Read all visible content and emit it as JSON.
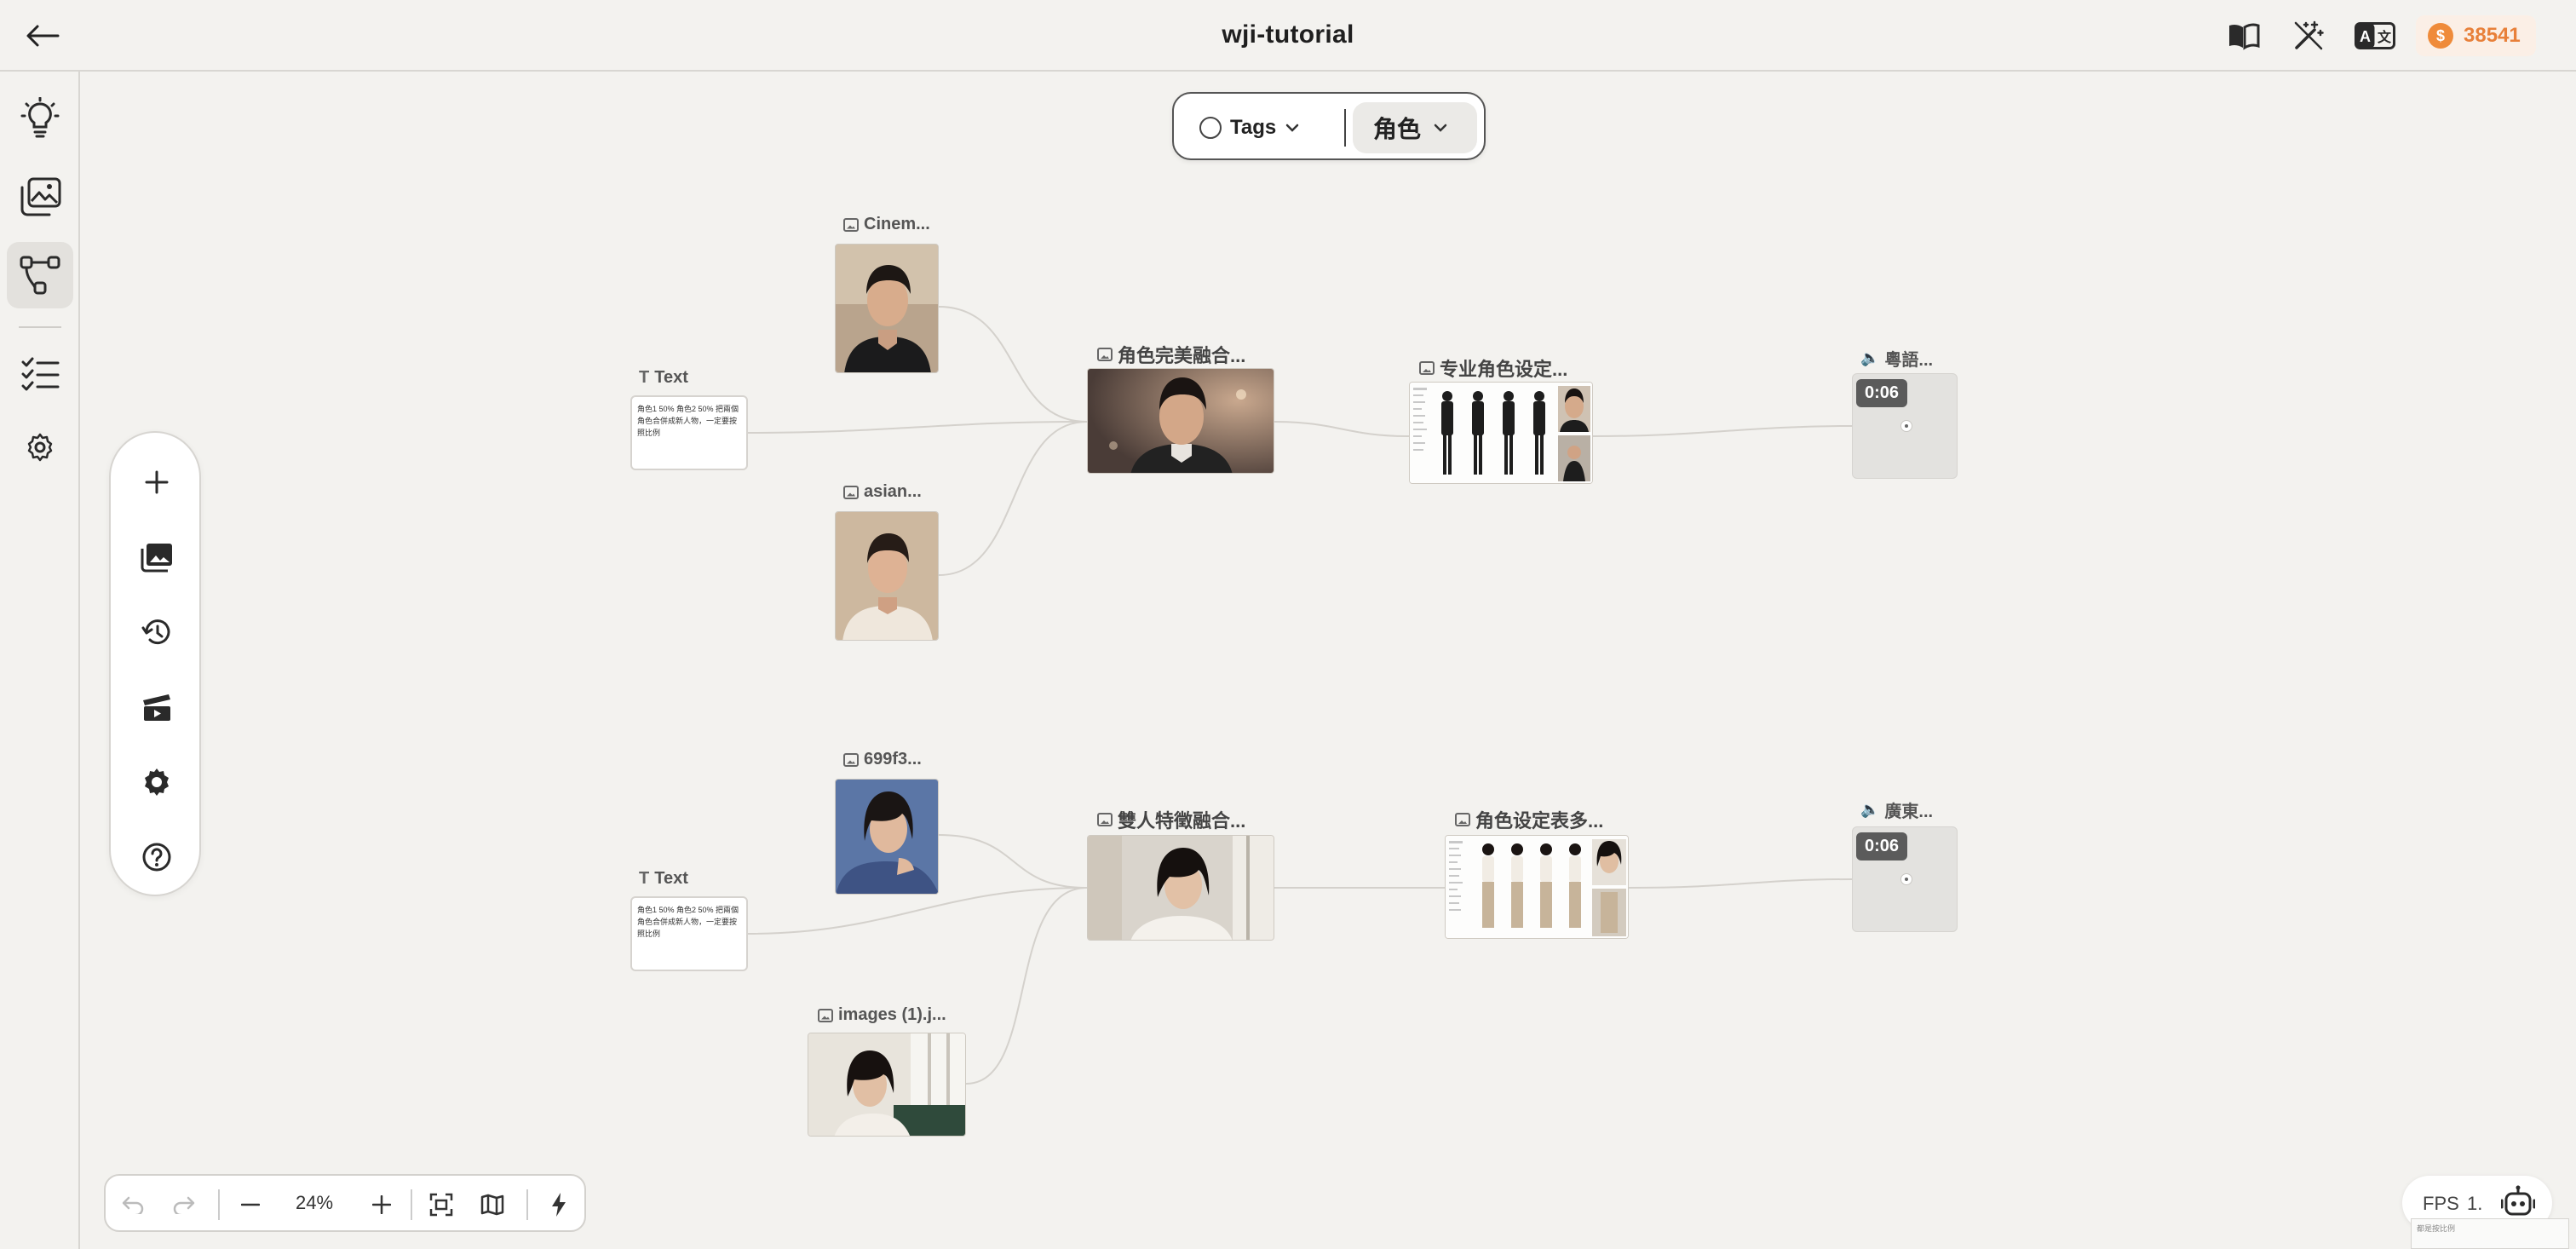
{
  "header": {
    "title": "wji-tutorial",
    "coins": "38541",
    "coin_symbol": "$",
    "icons": [
      "back-arrow-icon",
      "book-icon",
      "magic-wand-icon",
      "translate-icon",
      "coin-icon"
    ]
  },
  "rail": {
    "items": [
      {
        "name": "ideas",
        "icon": "lightbulb-icon"
      },
      {
        "name": "gallery",
        "icon": "images-icon"
      },
      {
        "name": "workflow",
        "icon": "workflow-icon",
        "active": true
      },
      {
        "name": "tasks",
        "icon": "checklist-icon"
      },
      {
        "name": "settings",
        "icon": "gear-icon"
      }
    ]
  },
  "palette": {
    "items": [
      "plus-icon",
      "gallery-icon",
      "history-icon",
      "clapperboard-icon",
      "gear-icon",
      "help-icon"
    ]
  },
  "tag_filter": {
    "tags_label": "Tags",
    "category": "角色"
  },
  "nodes": {
    "group1": {
      "img_a": "Cinem...",
      "img_b": "asian...",
      "text_label": "Text",
      "text_content": "角色1 50% 角色2 50% 把兩個角色合併成新人物，一定要按照比例",
      "merge_label": "角色完美融合...",
      "sheet_label": "专业角色设定...",
      "audio_label": "粵語...",
      "audio_time": "0:06"
    },
    "group2": {
      "img_a": "699f3...",
      "img_b": "images (1).j...",
      "text_label": "Text",
      "text_content": "角色1 50% 角色2 50% 把兩個角色合併成新人物，一定要按照比例",
      "merge_label": "雙人特徵融合...",
      "sheet_label": "角色设定表多...",
      "audio_label": "廣東...",
      "audio_time": "0:06"
    }
  },
  "bottom_bar": {
    "zoom": "24%",
    "icons": [
      "undo-icon",
      "redo-icon",
      "zoom-out-icon",
      "zoom-in-icon",
      "fit-view-icon",
      "map-icon",
      "lightning-icon"
    ]
  },
  "fps": {
    "label": "FPS",
    "value": "1."
  },
  "minimap_text": "都是按比例"
}
